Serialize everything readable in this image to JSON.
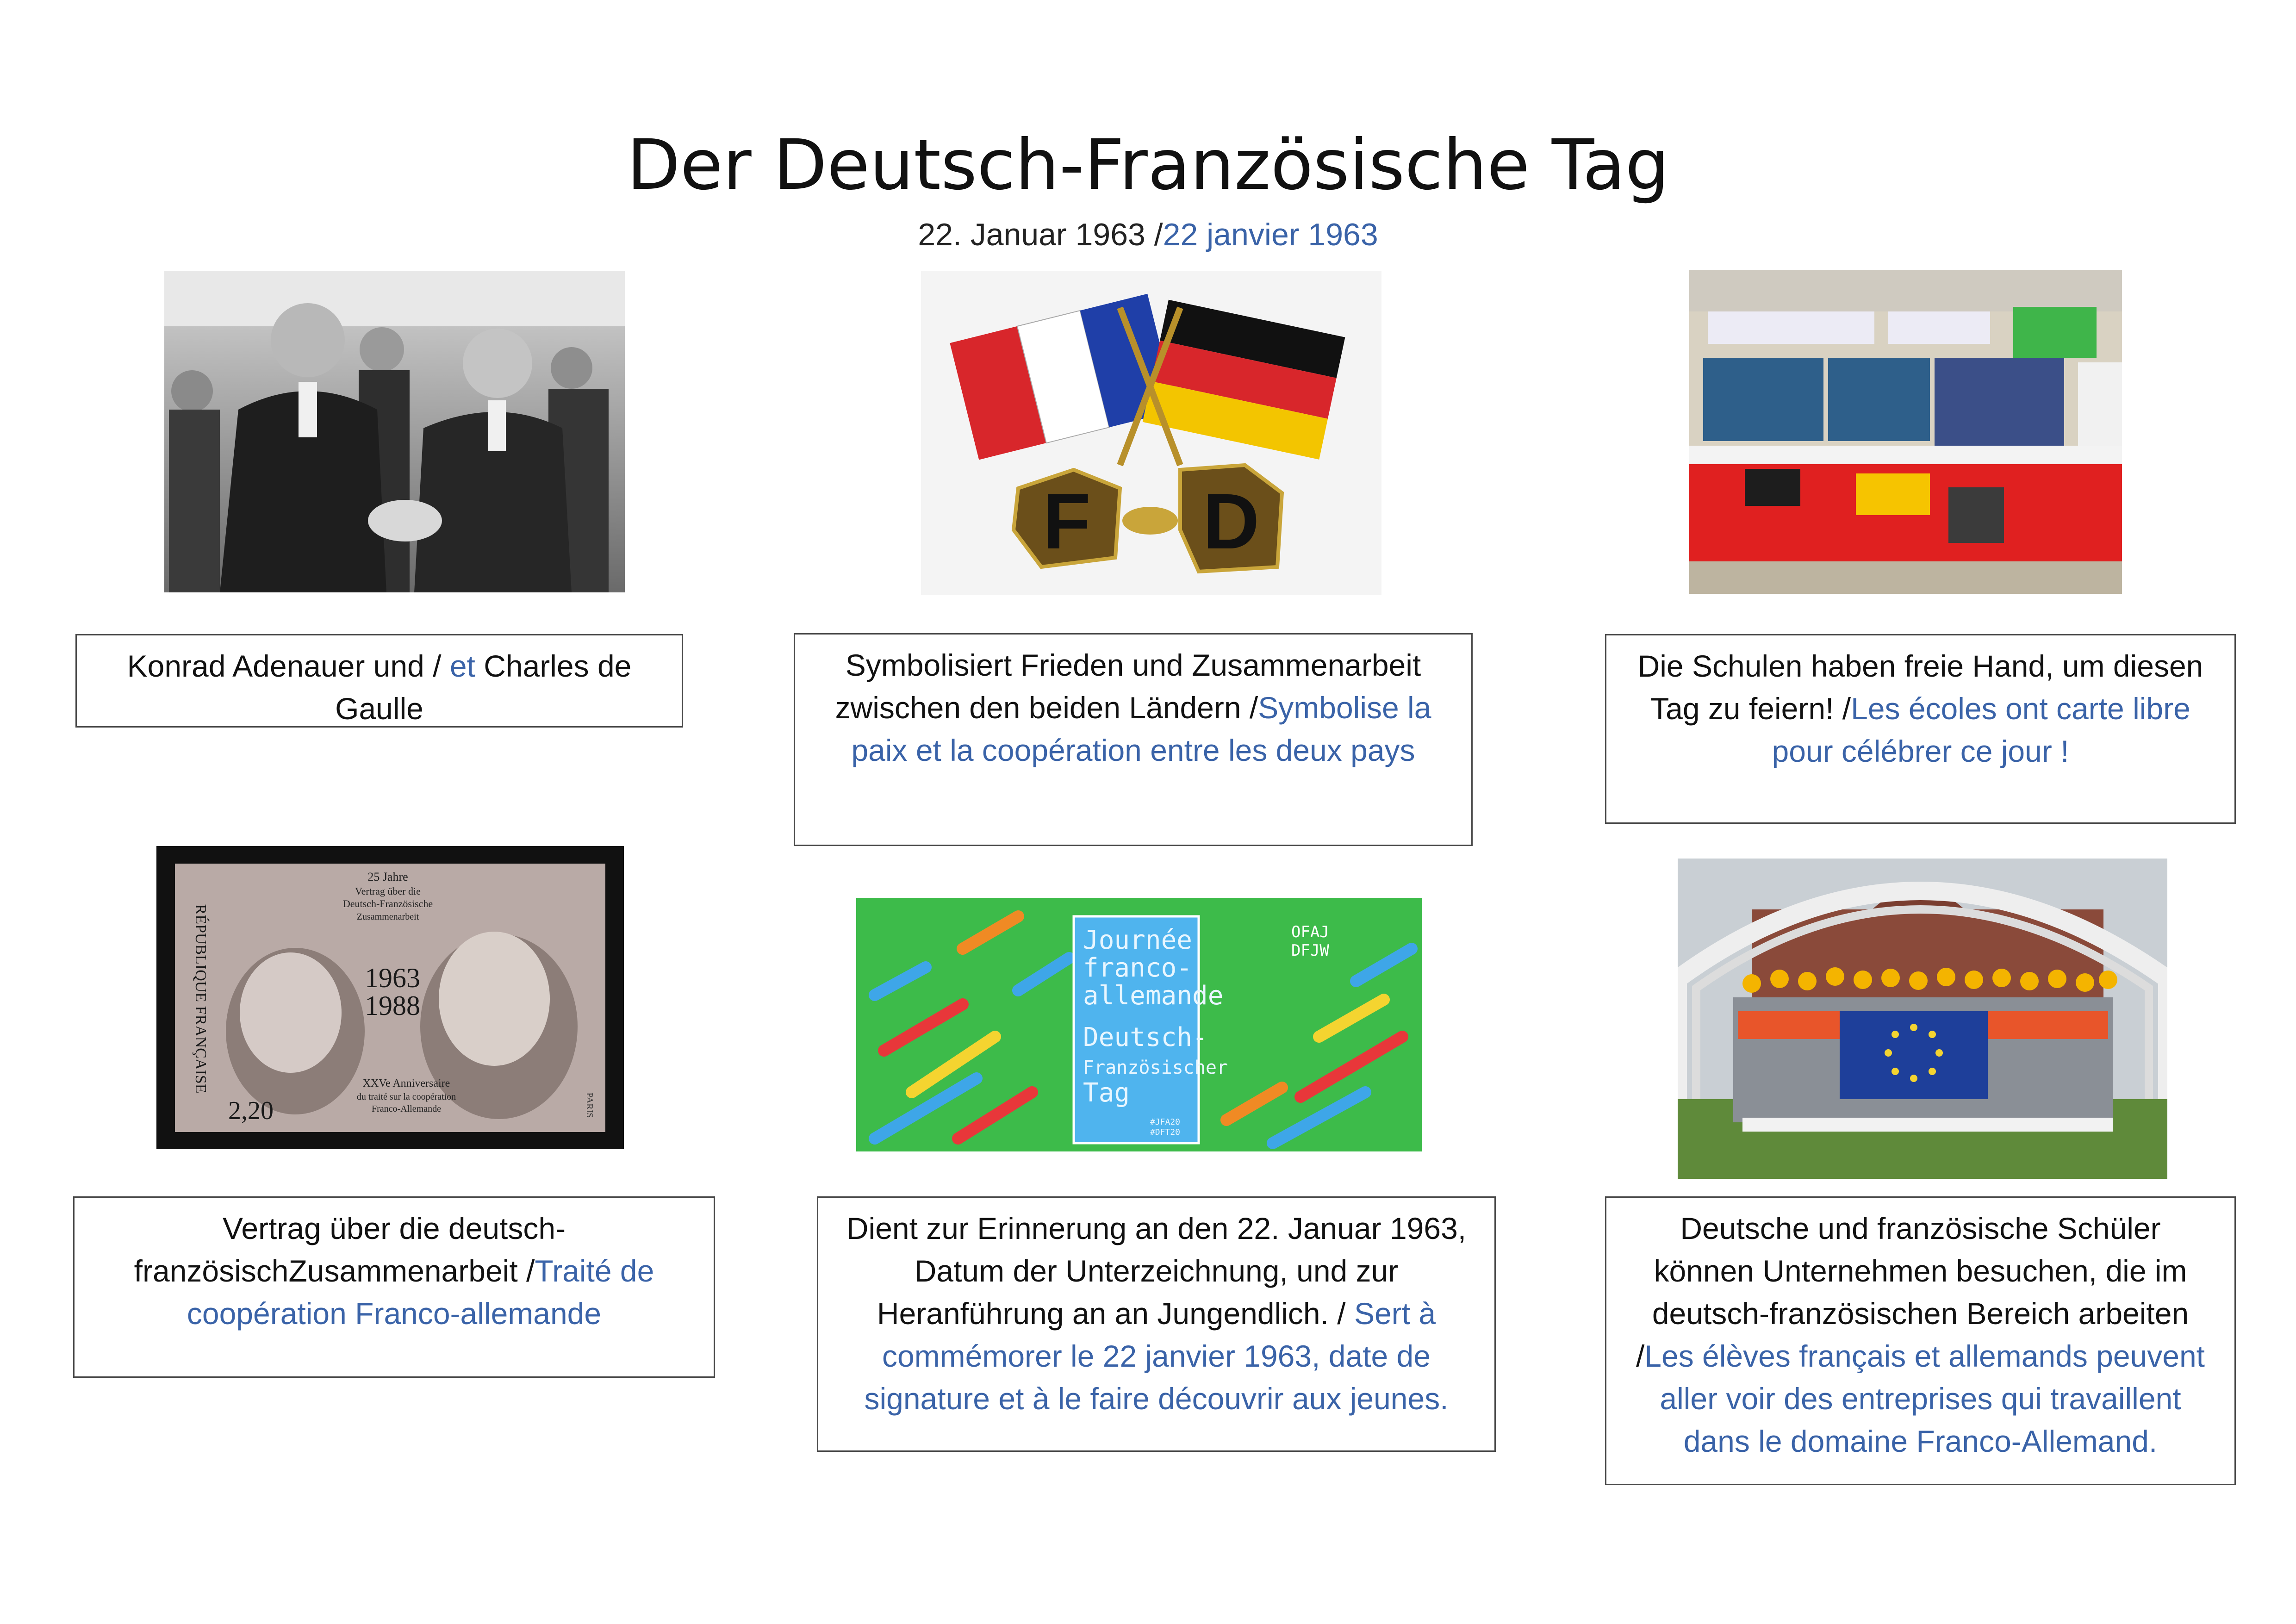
{
  "header": {
    "title": "Der Deutsch-Französische Tag",
    "date_de": "22. Januar 1963 /",
    "date_fr": "22 janvier 1963"
  },
  "images": {
    "leaders_photo": "black-and-white photo of Charles de Gaulle and Konrad Adenauer shaking hands",
    "flags_pin": "crossed French and German flag pin",
    "flag_pin_letters": [
      "F",
      "D"
    ],
    "school_exhibit": "school exhibition table in German and French colours",
    "stamp_text": [
      "RÉPUBLIQUE FRANÇAISE",
      "25 Jahre",
      "Vertrag über die",
      "Deutsch-Französische",
      "Zusammenarbeit",
      "1963",
      "1988",
      "XXVe Anniversaire",
      "du traité sur la coopération",
      "Franco-Allemande",
      "2,20",
      "PARIS"
    ],
    "journee_banner_text": [
      "Journée",
      "franco-",
      "allemande",
      "Deutsch-",
      "Französischer",
      "Tag"
    ],
    "banner_logo_text": [
      "OFAJ",
      "DFJW"
    ],
    "banner_tags": [
      "#JFA20",
      "#DFT20"
    ],
    "students_photo": "group of students in helmets holding a European flag"
  },
  "captions": {
    "c1": {
      "de": "Konrad Adenauer und / ",
      "fr": "et",
      "de2": " Charles de Gaulle"
    },
    "c2": {
      "de": "Symbolisiert Frieden und Zusammenarbeit zwischen den beiden Ländern /",
      "fr": "Symbolise la paix et la coopération entre les deux pays"
    },
    "c3": {
      "de": "Die Schulen haben freie Hand, um diesen Tag zu feiern! /",
      "fr": "Les écoles ont carte libre pour célébrer ce jour !"
    },
    "c4": {
      "de": "Vertrag über die deutsch-französischZusammenarbeit /",
      "fr": "Traité de coopération Franco-allemande"
    },
    "c5": {
      "de": "Dient zur Erinnerung an den 22. Januar 1963, Datum der Unterzeichnung, und zur Heranführung an an Jungendlich. / ",
      "fr": "Sert à commémorer le 22 janvier 1963, date de signature et à le faire découvrir aux jeunes."
    },
    "c6": {
      "de": "Deutsche und französische Schüler können Unternehmen besuchen, die im deutsch-französischen Bereich arbeiten /",
      "fr": "Les élèves français et allemands peuvent aller voir des entreprises qui travaillent dans le domaine Franco-Allemand."
    }
  },
  "colors": {
    "french_text": "#3a63a8",
    "banner_green": "#3dbb4a",
    "banner_blue": "#3ea6e8",
    "flag_blue": "#1f3fa8",
    "flag_red": "#d8262b",
    "flag_gold": "#f3c500"
  }
}
